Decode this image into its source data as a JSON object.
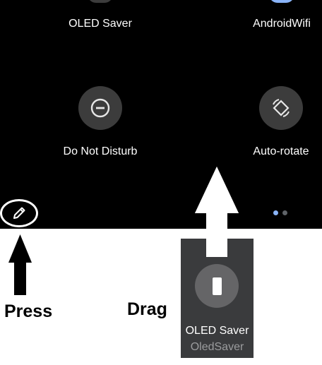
{
  "quick_settings": {
    "tiles": [
      {
        "label": "OLED Saver",
        "icon": "phone-icon"
      },
      {
        "label": "AndroidWifi",
        "icon": "wifi-icon"
      },
      {
        "label": "Do Not Disturb",
        "icon": "do-not-disturb-icon"
      },
      {
        "label": "Auto-rotate",
        "icon": "auto-rotate-icon"
      }
    ],
    "page_indicator": {
      "pages": 2,
      "active_page": 1
    },
    "edit_icon": "pencil-icon"
  },
  "annotations": {
    "press_label": "Press",
    "drag_label": "Drag"
  },
  "drag_tile": {
    "title": "OLED Saver",
    "subtitle": "OledSaver",
    "icon": "phone-icon"
  },
  "colors": {
    "panel_bg": "#000000",
    "tile_circle": "#3c3c3c",
    "dot_active": "#8ab4f8",
    "dot_inactive": "#5f6368",
    "drag_tile_bg": "#3a3b3d"
  }
}
